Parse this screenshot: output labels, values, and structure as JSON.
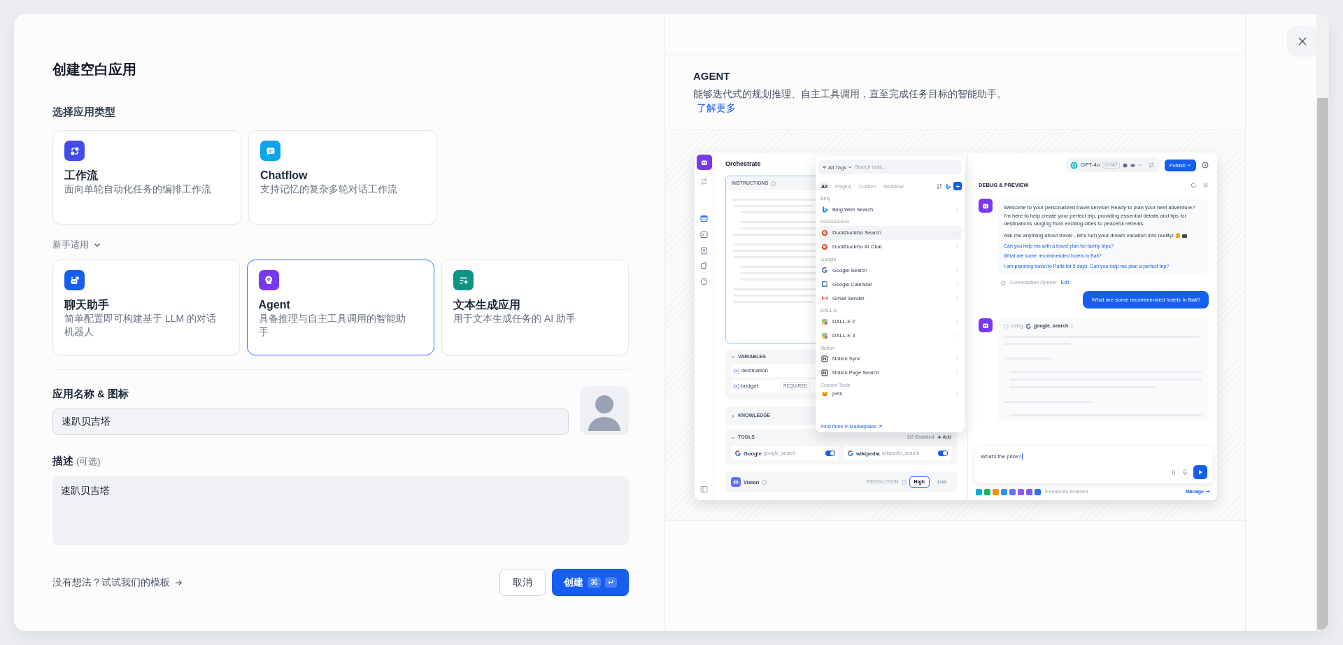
{
  "dialog": {
    "title": "创建空白应用",
    "section_label": "选择应用类型",
    "app_types": [
      {
        "kind": "workflow",
        "name": "工作流",
        "description": "面向单轮自动化任务的编排工作流",
        "color": "#444ce7",
        "selected": false
      },
      {
        "kind": "chatflow",
        "name": "Chatflow",
        "description": "支持记忆的复杂多轮对话工作流",
        "color": "#0ba5ec",
        "selected": false
      }
    ],
    "beginner_toggle": {
      "label": "新手适用",
      "expanded": true
    },
    "beginner_types": [
      {
        "kind": "chatbot",
        "name": "聊天助手",
        "description": "简单配置即可构建基于 LLM 的对话机器人",
        "color": "#155eef",
        "selected": false
      },
      {
        "kind": "agent",
        "name": "Agent",
        "description": "具备推理与自主工具调用的智能助手",
        "color": "#7839ee",
        "selected": true
      },
      {
        "kind": "text",
        "name": "文本生成应用",
        "description": "用于文本生成任务的 AI 助手",
        "color": "#0e9384",
        "selected": false
      }
    ],
    "name_field": {
      "label": "应用名称 & 图标",
      "value": "速趴贝吉塔"
    },
    "description_field": {
      "label": "描述",
      "hint": "(可选)",
      "value": "速趴贝吉塔"
    },
    "template_link": "没有想法？试试我们的模板",
    "cancel_button": "取消",
    "create_button": "创建",
    "shortcut_keys": [
      "⌘",
      "↵"
    ]
  },
  "info": {
    "title": "AGENT",
    "description": "能够迭代式的规划推理、自主工具调用，直至完成任务目标的智能助手。",
    "link": "了解更多"
  },
  "preview": {
    "title": "Orchestrate",
    "instructions_label": "INSTRUCTIONS",
    "variables": {
      "label": "VARIABLES",
      "expanded": true,
      "items": [
        {
          "icon_text": "{x}",
          "name": "destination"
        },
        {
          "icon_text": "{x}",
          "name": "budget",
          "badge": "REQUIRED"
        }
      ]
    },
    "knowledge": {
      "label": "KNOWLEDGE",
      "expanded": false
    },
    "tools": {
      "label": "TOOLS",
      "expanded": true,
      "count": "2/2 Enabled",
      "add": "Add",
      "items": [
        {
          "name": "Google",
          "tool_id": "google_search",
          "on": true
        },
        {
          "name": "wikipedia",
          "tool_id": "wikipedia_search",
          "on": true
        }
      ]
    },
    "vision": {
      "label": "Vision",
      "resolution_label": "RESOLUTION",
      "options": [
        {
          "label": "High",
          "selected": true
        },
        {
          "label": "Low",
          "selected": false
        }
      ]
    },
    "tool_picker": {
      "tag_filter": "All Tags",
      "placeholder": "Search tools...",
      "tabs": [
        {
          "label": "All",
          "selected": true
        },
        {
          "label": "Plugins",
          "selected": false
        },
        {
          "label": "Custom",
          "selected": false
        },
        {
          "label": "Workflow",
          "selected": false
        }
      ],
      "groups": [
        {
          "name": "Bing",
          "tools": [
            {
              "kind": "bing",
              "name": "Bing Web Search",
              "selected": false
            }
          ]
        },
        {
          "name": "DuckDuckGo",
          "tools": [
            {
              "kind": "duck",
              "name": "DuckDuckGo Search",
              "selected": true
            },
            {
              "kind": "duck",
              "name": "DuckDuckGo AI Chat",
              "selected": false
            }
          ]
        },
        {
          "name": "Google",
          "tools": [
            {
              "kind": "google",
              "name": "Google Search",
              "selected": false
            },
            {
              "kind": "calendar",
              "name": "Google Calendar",
              "selected": false
            },
            {
              "kind": "gmail",
              "name": "Gmail Sender",
              "selected": false
            }
          ]
        },
        {
          "name": "DALL-E",
          "tools": [
            {
              "kind": "dalle",
              "name": "DALL-E 2",
              "selected": false
            },
            {
              "kind": "dalle",
              "name": "DALL-E 3",
              "selected": false
            }
          ]
        },
        {
          "name": "Notion",
          "tools": [
            {
              "kind": "notion",
              "name": "Notion Sync",
              "selected": false
            },
            {
              "kind": "notion",
              "name": "Notion Page Search",
              "selected": false
            }
          ]
        },
        {
          "name": "Custom Tools",
          "tools": [
            {
              "kind": "custom",
              "name": "pets",
              "selected": false
            }
          ]
        }
      ],
      "footer_link": "Find more in Marketplace"
    },
    "model": {
      "name": "GPT-4o",
      "mode": "CHAT"
    },
    "publish": "Publish",
    "debug_title": "DEBUG & PREVIEW",
    "welcome": [
      "Welcome to your personalized travel service! Ready to plan your next adventure? I'm here to help create your perfect trip, providing essential details and tips for destinations ranging from exciting cities to peaceful retreats.",
      "Ask me anything about travel - let's turn your dream vacation into reality!"
    ],
    "suggestions": [
      "Can you help me with a travel plan for family trips?",
      "What are some recommended hotels in Bali?",
      "I am planning travel to Paris for 5 days. Can you help me plan a perfect trip?"
    ],
    "opener_label": "Conversation Opener",
    "edit_link": "Edit",
    "user_message": "What are some recommended hotels in Bali?",
    "using_label": "Using",
    "using_tool": "google_search",
    "input_value": "What's the price?",
    "feature_icons": [
      {
        "color": "#06aed4"
      },
      {
        "color": "#16b364"
      },
      {
        "color": "#f79009"
      },
      {
        "color": "#2e90fa"
      },
      {
        "color": "#6172f3"
      },
      {
        "color": "#875bf7"
      },
      {
        "color": "#7a5af8"
      },
      {
        "color": "#2970ff"
      }
    ],
    "features_text": "8 Features Enabled",
    "manage_link": "Manage"
  }
}
